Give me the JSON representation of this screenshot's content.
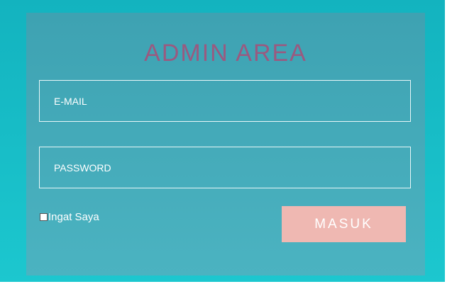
{
  "login": {
    "title": "ADMIN AREA",
    "email_placeholder": "E-MAIL",
    "password_placeholder": "PASSWORD",
    "remember_label": "Ingat Saya",
    "submit_label": "MASUK"
  },
  "colors": {
    "background": "#13b3bf",
    "panel": "#3ea2b2",
    "title": "#9a5a80",
    "button": "#efb8b2"
  }
}
